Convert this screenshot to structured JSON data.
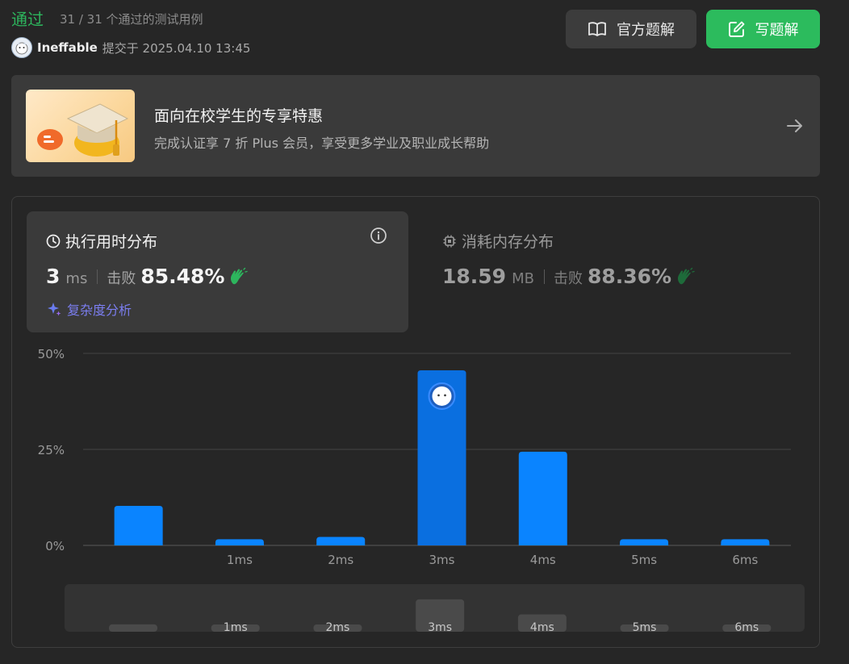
{
  "header": {
    "status": "通过",
    "cases": "31 / 31 个通过的测试用例",
    "username": "Ineffable",
    "submitted": "提交于 2025.04.10 13:45",
    "official_solution_label": "官方题解",
    "write_solution_label": "写题解"
  },
  "promo": {
    "title": "面向在校学生的专享特惠",
    "subtitle": "完成认证享 7 折 Plus 会员，享受更多学业及职业成长帮助"
  },
  "runtime": {
    "title": "执行用时分布",
    "value": "3",
    "unit": "ms",
    "beat_label": "击败",
    "beat": "85.48%",
    "complexity_label": "复杂度分析"
  },
  "memory": {
    "title": "消耗内存分布",
    "value": "18.59",
    "unit": "MB",
    "beat_label": "击败",
    "beat": "88.36%"
  },
  "colors": {
    "accent_green": "#2cbb5d",
    "bar_blue": "#0a84ff",
    "bar_highlight": "#0a6fe0"
  },
  "chart_data": {
    "type": "bar",
    "categories": [
      "",
      "1ms",
      "2ms",
      "3ms",
      "4ms",
      "5ms",
      "6ms"
    ],
    "values": [
      10.3,
      1.6,
      2.2,
      45.6,
      24.4,
      1.6,
      1.6
    ],
    "highlight_index": 3,
    "y_ticks": [
      "0%",
      "25%",
      "50%"
    ],
    "y_tick_values": [
      0,
      25,
      50
    ],
    "ylim": [
      0,
      50
    ],
    "ylabel": "",
    "xlabel": "",
    "grid": true,
    "overview_labels": [
      "",
      "1ms",
      "2ms",
      "3ms",
      "4ms",
      "5ms",
      "6ms"
    ]
  }
}
